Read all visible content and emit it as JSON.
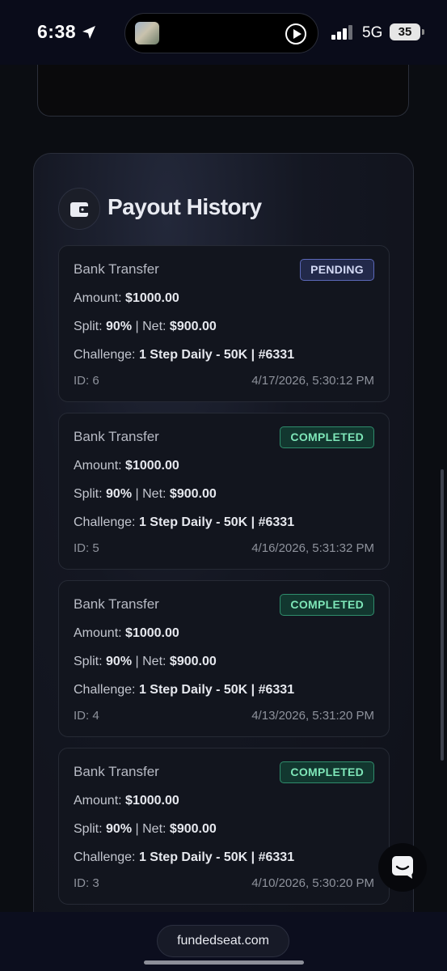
{
  "status_bar": {
    "time": "6:38",
    "network": "5G",
    "battery": "35"
  },
  "panel": {
    "title": "Payout History"
  },
  "payouts": [
    {
      "method": "Bank Transfer",
      "status": "PENDING",
      "amount_label": "Amount:",
      "amount": "$1000.00",
      "split_label": "Split:",
      "split": "90%",
      "net_label": "| Net:",
      "net": "$900.00",
      "challenge_label": "Challenge:",
      "challenge": "1 Step Daily - 50K | #6331",
      "id": "ID: 6",
      "date": "4/17/2026, 5:30:12 PM"
    },
    {
      "method": "Bank Transfer",
      "status": "COMPLETED",
      "amount_label": "Amount:",
      "amount": "$1000.00",
      "split_label": "Split:",
      "split": "90%",
      "net_label": "| Net:",
      "net": "$900.00",
      "challenge_label": "Challenge:",
      "challenge": "1 Step Daily - 50K | #6331",
      "id": "ID: 5",
      "date": "4/16/2026, 5:31:32 PM"
    },
    {
      "method": "Bank Transfer",
      "status": "COMPLETED",
      "amount_label": "Amount:",
      "amount": "$1000.00",
      "split_label": "Split:",
      "split": "90%",
      "net_label": "| Net:",
      "net": "$900.00",
      "challenge_label": "Challenge:",
      "challenge": "1 Step Daily - 50K | #6331",
      "id": "ID: 4",
      "date": "4/13/2026, 5:31:20 PM"
    },
    {
      "method": "Bank Transfer",
      "status": "COMPLETED",
      "amount_label": "Amount:",
      "amount": "$1000.00",
      "split_label": "Split:",
      "split": "90%",
      "net_label": "| Net:",
      "net": "$900.00",
      "challenge_label": "Challenge:",
      "challenge": "1 Step Daily - 50K | #6331",
      "id": "ID: 3",
      "date": "4/10/2026, 5:30:20 PM"
    }
  ],
  "browser": {
    "url": "fundedseat.com"
  },
  "icons": {
    "wallet": "wallet-icon",
    "chat": "chat-icon",
    "location": "location-arrow-icon",
    "signal": "signal-icon",
    "play": "play-icon"
  },
  "colors": {
    "pending_badge": "#22294a",
    "completed_badge": "#12372f",
    "completed_text": "#7ee6b8"
  }
}
